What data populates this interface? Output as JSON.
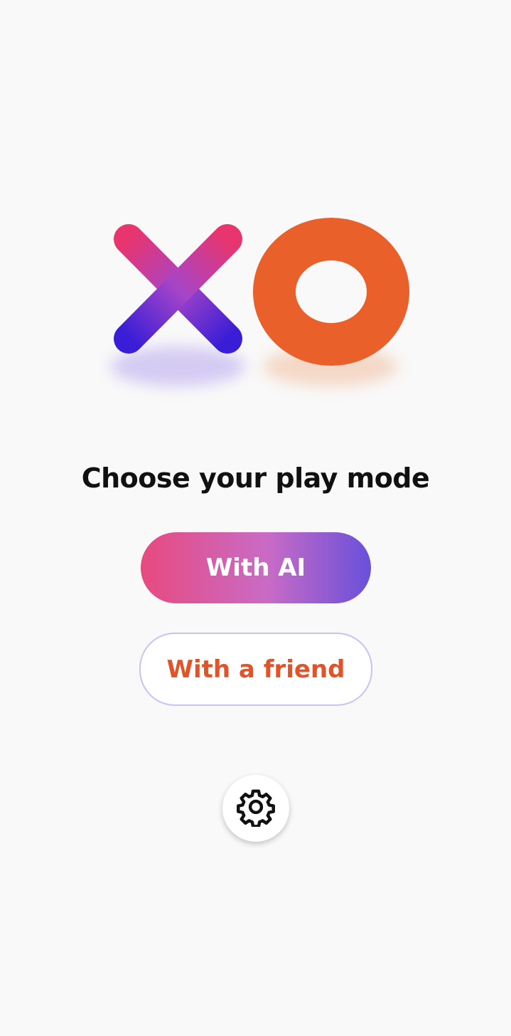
{
  "logo": {
    "icon": "xo-logo",
    "x_gradient": [
      "#e8356f",
      "#a645c8",
      "#3a1dd6"
    ],
    "o_color": "#e9602b"
  },
  "main": {
    "title": "Choose your play mode",
    "with_ai_label": "With AI",
    "with_friend_label": "With a friend"
  },
  "settings": {
    "icon": "gear-icon"
  },
  "colors": {
    "background": "#f9f9f9",
    "accent_orange": "#e3532a",
    "ai_gradient": [
      "#e74a7f",
      "#c96bc6",
      "#6950da"
    ],
    "friend_border": "#c9c2f5"
  }
}
